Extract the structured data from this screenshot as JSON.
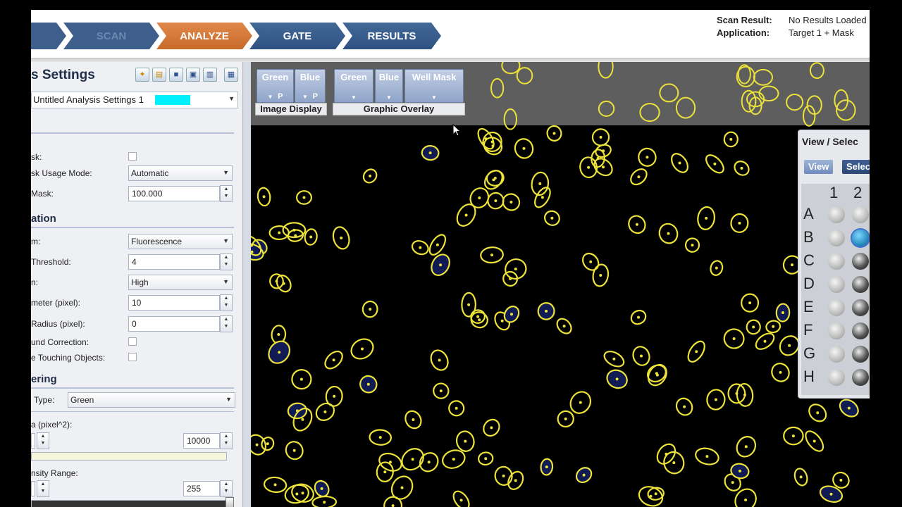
{
  "workflow": {
    "steps": [
      "",
      "SCAN",
      "ANALYZE",
      "GATE",
      "RESULTS"
    ],
    "active": "ANALYZE"
  },
  "info": {
    "scan_result_label": "Scan Result:",
    "scan_result_value": "No Results Loaded",
    "application_label": "Application:",
    "application_value": "Target 1 + Mask"
  },
  "panel": {
    "title": "s Settings",
    "settings_name": "Untitled Analysis Settings 1",
    "settings_color": "#00f0ff",
    "mask_section": {
      "use_mask_label": "sk:",
      "usage_mode_label": "sk Usage Mode:",
      "usage_mode_value": "Automatic",
      "mask_label": "Mask:",
      "mask_value": "100.000"
    },
    "identification": {
      "title": "ation",
      "algorithm_label": "m:",
      "algorithm_value": "Fluorescence",
      "threshold_label": "Threshold:",
      "threshold_value": "4",
      "sensitivity_label": "n:",
      "sensitivity_value": "High",
      "diameter_label": "meter (pixel):",
      "diameter_value": "10",
      "radius_label": "Radius (pixel):",
      "radius_value": "0",
      "bg_correction_label": "und Correction:",
      "touching_label": "e Touching Objects:"
    },
    "filtering": {
      "title": "ering",
      "type_label": "Type:",
      "type_value": "Green",
      "area_label": "a (pixel^2):",
      "area_max": "10000",
      "intensity_label": "nsity Range:",
      "intensity_max": "255"
    }
  },
  "overlay": {
    "image_display_buttons": [
      "Green",
      "Blue"
    ],
    "image_display_group": "Image Display",
    "graphic_overlay_buttons": [
      "Green",
      "Blue",
      "Well Mask"
    ],
    "graphic_overlay_group": "Graphic Overlay",
    "p_label": "P"
  },
  "plate": {
    "title": "View / Selec",
    "view_button": "View",
    "select_button": "Selec",
    "columns": [
      "1",
      "2"
    ],
    "rows": [
      "A",
      "B",
      "C",
      "D",
      "E",
      "F",
      "G",
      "H"
    ],
    "selected_well": "B2",
    "selected_color": "#2a8fc0"
  },
  "colors": {
    "outline": "#ece23a",
    "cell_fill": "#101a55",
    "accent_active": "#d27530",
    "accent_step": "#3a5e90"
  }
}
